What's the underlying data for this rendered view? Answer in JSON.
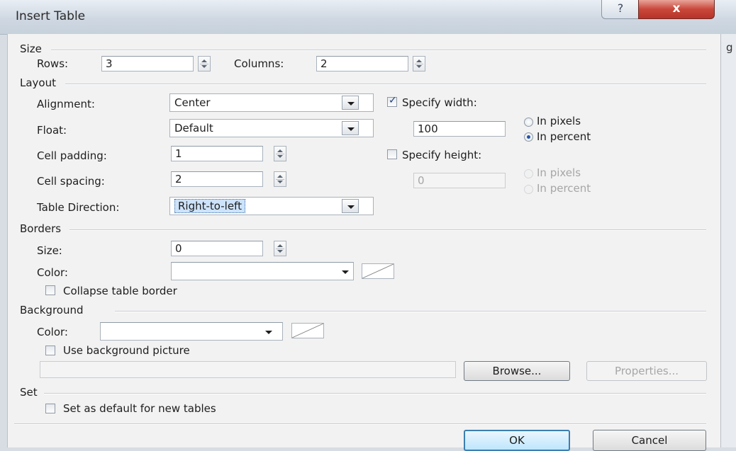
{
  "window": {
    "title": "Insert Table",
    "help_label": "?",
    "close_label": "x",
    "background_window_char": "g"
  },
  "size": {
    "header": "Size",
    "rows_label": "Rows:",
    "rows_value": "3",
    "columns_label": "Columns:",
    "columns_value": "2"
  },
  "layout": {
    "header": "Layout",
    "alignment_label": "Alignment:",
    "alignment_value": "Center",
    "float_label": "Float:",
    "float_value": "Default",
    "cell_padding_label": "Cell padding:",
    "cell_padding_value": "1",
    "cell_spacing_label": "Cell spacing:",
    "cell_spacing_value": "2",
    "direction_label": "Table Direction:",
    "direction_value": "Right-to-left",
    "specify_width_label": "Specify width:",
    "specify_width_checked": true,
    "width_value": "100",
    "width_pixels_label": "In pixels",
    "width_percent_label": "In percent",
    "specify_height_label": "Specify height:",
    "specify_height_checked": false,
    "height_value": "0",
    "height_pixels_label": "In pixels",
    "height_percent_label": "In percent"
  },
  "borders": {
    "header": "Borders",
    "size_label": "Size:",
    "size_value": "0",
    "color_label": "Color:",
    "collapse_label": "Collapse table border"
  },
  "background": {
    "header": "Background",
    "color_label": "Color:",
    "use_picture_label": "Use background picture",
    "picture_path": "",
    "browse_label": "Browse...",
    "properties_label": "Properties..."
  },
  "set": {
    "header": "Set",
    "default_label": "Set as default for new tables"
  },
  "footer": {
    "ok_label": "OK",
    "cancel_label": "Cancel"
  },
  "colors": {
    "accent": "#3c7fb1",
    "radio_dot": "#2453a8",
    "close_red": "#c8473a"
  }
}
